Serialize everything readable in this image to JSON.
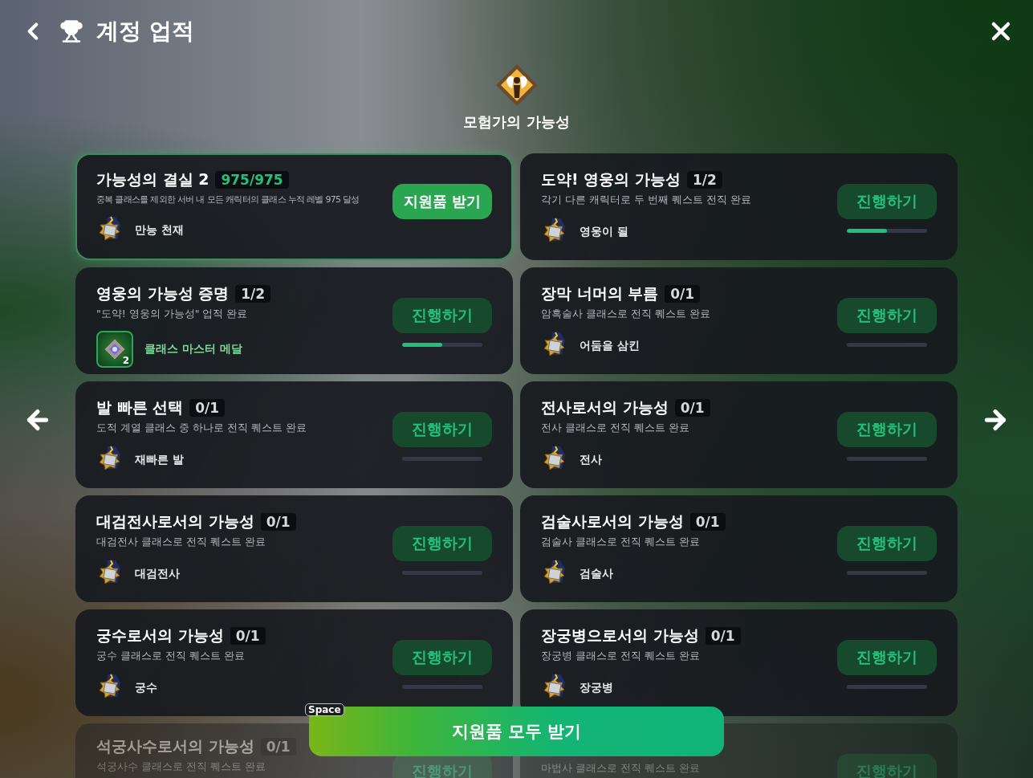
{
  "header": {
    "title": "계정 업적"
  },
  "category": {
    "title": "모험가의 가능성"
  },
  "cards": [
    {
      "title": "가능성의 결실 2",
      "count": "975/975",
      "claimable": true,
      "desc": "중복 클래스를 제외한 서버 내 모든 캐릭터의 클래스 누적 레벨 975 달성",
      "reward": {
        "kind": "title",
        "name": "만능 천재"
      },
      "button": "지원품 받기"
    },
    {
      "title": "도약! 영웅의 가능성",
      "count": "1/2",
      "claimable": false,
      "desc": "각기 다른 캐릭터로 두 번째 퀘스트 전직 완료",
      "reward": {
        "kind": "title",
        "name": "영웅이 될"
      },
      "button": "진행하기",
      "level": 0.5
    },
    {
      "title": "영웅의 가능성 증명",
      "count": "1/2",
      "claimable": false,
      "desc": "\"도약! 영웅의 가능성\" 업적 완료",
      "reward": {
        "kind": "item",
        "name": "클래스 마스터 메달",
        "quantity": "2"
      },
      "button": "진행하기",
      "level": 0.5
    },
    {
      "title": "장막 너머의 부름",
      "count": "0/1",
      "claimable": false,
      "desc": "암흑술사 클래스로 전직 퀘스트 완료",
      "reward": {
        "kind": "title",
        "name": "어둠을 삼킨"
      },
      "button": "진행하기"
    },
    {
      "title": "발 빠른 선택",
      "count": "0/1",
      "claimable": false,
      "desc": "도적 계열 클래스 중 하나로 전직 퀘스트 완료",
      "reward": {
        "kind": "title",
        "name": "재빠른 발"
      },
      "button": "진행하기"
    },
    {
      "title": "전사로서의 가능성",
      "count": "0/1",
      "claimable": false,
      "desc": "전사 클래스로 전직 퀘스트 완료",
      "reward": {
        "kind": "title",
        "name": "전사"
      },
      "button": "진행하기"
    },
    {
      "title": "대검전사로서의 가능성",
      "count": "0/1",
      "claimable": false,
      "desc": "대검전사 클래스로 전직 퀘스트 완료",
      "reward": {
        "kind": "title",
        "name": "대검전사"
      },
      "button": "진행하기"
    },
    {
      "title": "검술사로서의 가능성",
      "count": "0/1",
      "claimable": false,
      "desc": "검술사 클래스로 전직 퀘스트 완료",
      "reward": {
        "kind": "title",
        "name": "검술사"
      },
      "button": "진행하기"
    },
    {
      "title": "궁수로서의 가능성",
      "count": "0/1",
      "claimable": false,
      "desc": "궁수 클래스로 전직 퀘스트 완료",
      "reward": {
        "kind": "title",
        "name": "궁수"
      },
      "button": "진행하기"
    },
    {
      "title": "장궁병으로서의 가능성",
      "count": "0/1",
      "claimable": false,
      "desc": "장궁병 클래스로 전직 퀘스트 완료",
      "reward": {
        "kind": "title",
        "name": "장궁병"
      },
      "button": "진행하기"
    }
  ],
  "cut_cards": [
    {
      "title": "석궁사수로서의 가능성",
      "count": "0/1",
      "desc": "석궁사수 클래스로 전직 퀘스트 완료",
      "button": "진행하기"
    },
    {
      "desc": "마법사 클래스로 전직 퀘스트 완료",
      "button": "진행하기"
    }
  ],
  "claim_all": {
    "label": "지원품 모두 받기",
    "key": "Space"
  }
}
